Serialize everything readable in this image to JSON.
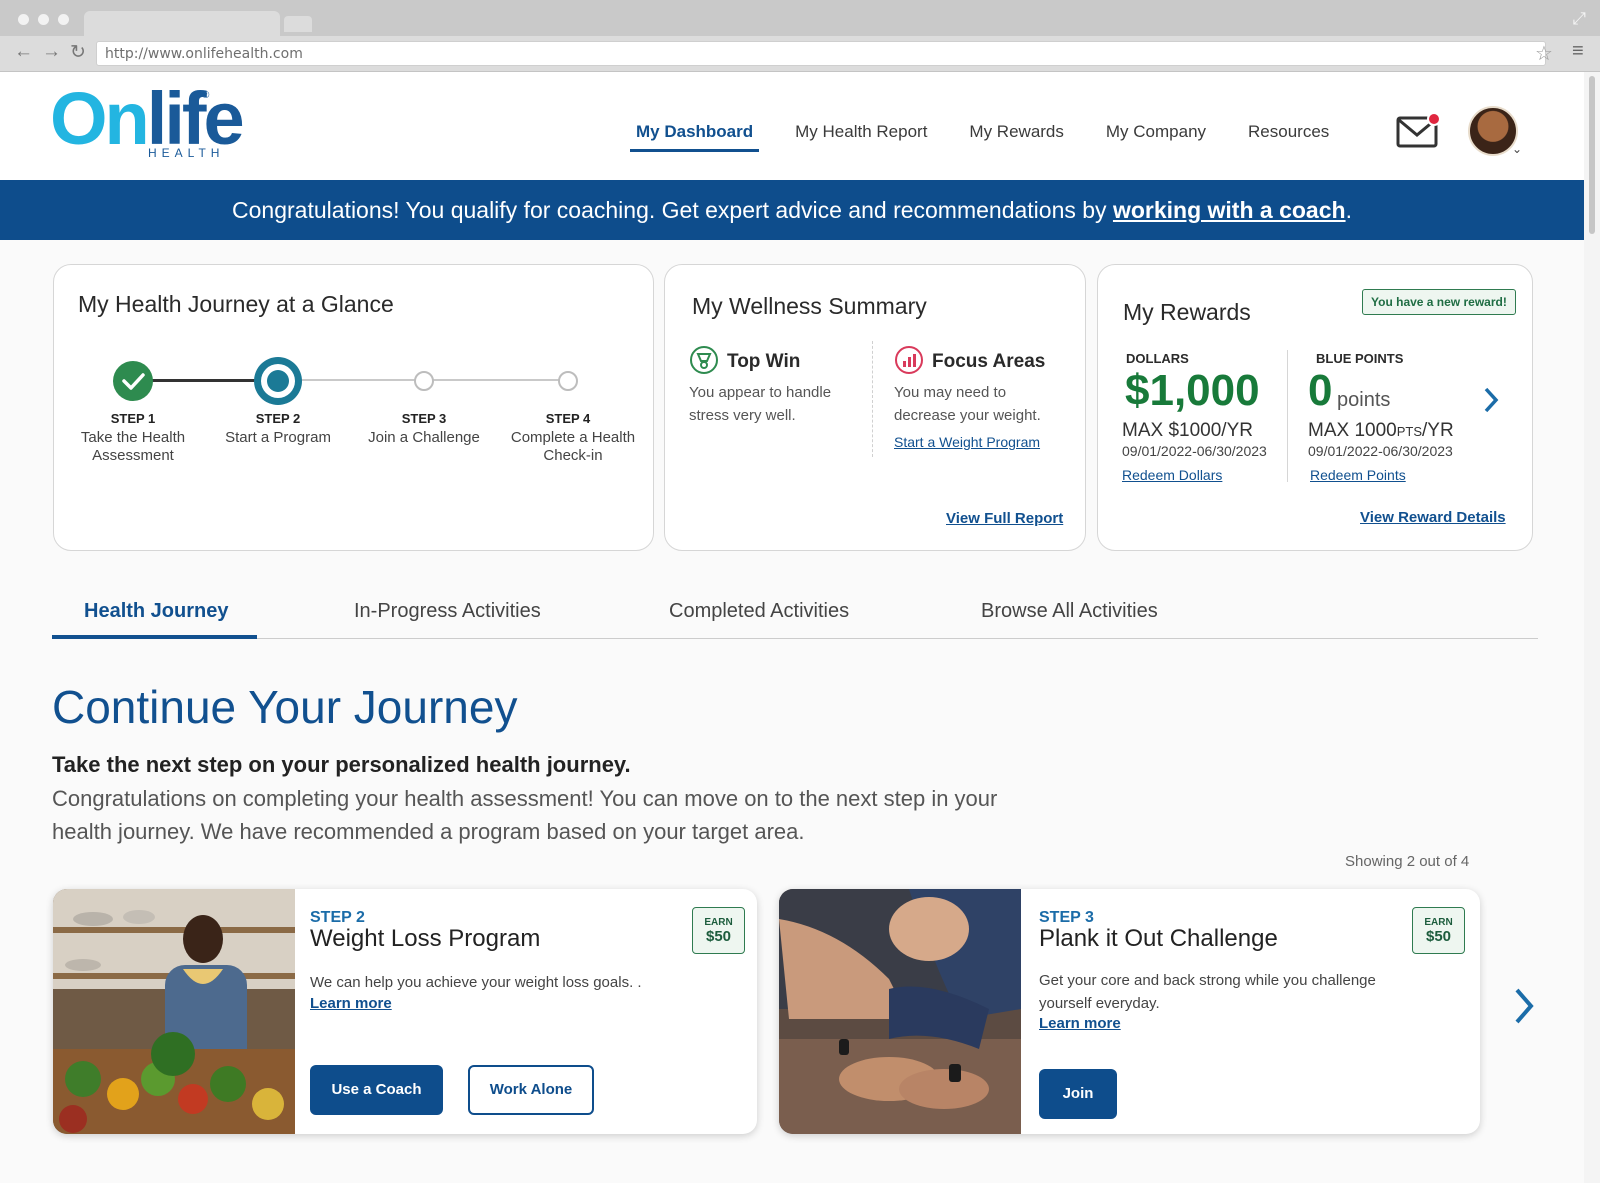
{
  "browser": {
    "url": "http://www.onlifehealth.com"
  },
  "logo": {
    "word_on": "On",
    "word_life": "life",
    "sub": "HEALTH",
    "reg": "®"
  },
  "nav": {
    "items": [
      "My Dashboard",
      "My Health Report",
      "My Rewards",
      "My Company",
      "Resources"
    ]
  },
  "banner": {
    "text": "Congratulations! You qualify for coaching. Get expert advice and recommendations by ",
    "link": "working with a coach",
    "end": "."
  },
  "journey": {
    "title": "My Health Journey at a Glance",
    "steps": [
      {
        "num": "STEP 1",
        "label": "Take the Health Assessment",
        "status": "complete"
      },
      {
        "num": "STEP 2",
        "label": "Start a Program",
        "status": "current"
      },
      {
        "num": "STEP 3",
        "label": "Join a Challenge",
        "status": "upcoming"
      },
      {
        "num": "STEP 4",
        "label": "Complete a Health Check-in",
        "status": "upcoming"
      }
    ]
  },
  "wellness": {
    "title": "My Wellness Summary",
    "top_win": {
      "head": "Top Win",
      "text": "You appear to handle stress very well."
    },
    "focus": {
      "head": "Focus Areas",
      "text": "You may need to decrease your weight.",
      "link": "Start a Weight Program"
    },
    "view_full": "View Full Report"
  },
  "rewards": {
    "title": "My Rewards",
    "new_badge": "You have a new reward!",
    "dollars": {
      "label": "DOLLARS",
      "value": "$1,000",
      "max": "MAX $1000/YR",
      "dates": "09/01/2022-06/30/2023",
      "link": "Redeem Dollars"
    },
    "points": {
      "label": "BLUE POINTS",
      "value": "0",
      "unit": "points",
      "max_prefix": "MAX 1000",
      "max_small": "PTS",
      "max_suffix": "/YR",
      "dates": "09/01/2022-06/30/2023",
      "link": "Redeem Points"
    },
    "view_details": "View Reward Details"
  },
  "tabs": [
    "Health Journey",
    "In-Progress Activities",
    "Completed Activities",
    "Browse All Activities"
  ],
  "continue": {
    "title": "Continue Your Journey",
    "subtitle": "Take the next step on your personalized health journey.",
    "body": "Congratulations on completing your health assessment! You can move on to the next step in your health journey. We have recommended a program based on your target area.",
    "showing": "Showing 2 out of 4"
  },
  "activities": [
    {
      "step": "STEP 2",
      "title": "Weight Loss Program",
      "desc": "We can help you achieve your weight loss goals. .",
      "learn": "Learn more",
      "earn_label": "EARN",
      "earn_value": "$50",
      "btn1": "Use a Coach",
      "btn2": "Work Alone"
    },
    {
      "step": "STEP 3",
      "title": "Plank it Out Challenge",
      "desc": "Get your core and back strong while you challenge yourself everyday.",
      "learn": "Learn more",
      "earn_label": "EARN",
      "earn_value": "$50",
      "btn1": "Join"
    }
  ],
  "colors": {
    "brand_blue": "#0e4d8c",
    "brand_cyan": "#23b5e1",
    "reward_green": "#187a3a",
    "step_complete": "#2e8b4f",
    "step_current": "#1b7a96"
  }
}
